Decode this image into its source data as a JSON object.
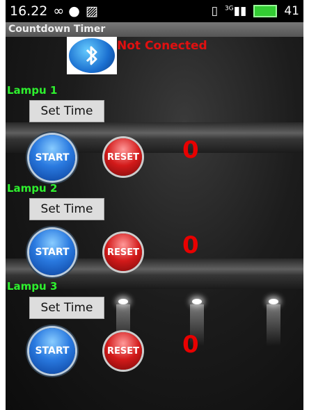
{
  "statusbar": {
    "time": "16.22",
    "left_icons": "∞ ●",
    "signal": "3G",
    "battery": "41"
  },
  "app": {
    "title": "Countdown Timer",
    "connection_status": "Not Conected"
  },
  "timers": [
    {
      "label": "Lampu 1",
      "set_time": "Set Time",
      "start": "START",
      "reset": "RESET",
      "count": "0"
    },
    {
      "label": "Lampu 2",
      "set_time": "Set Time",
      "start": "START",
      "reset": "RESET",
      "count": "0"
    },
    {
      "label": "Lampu 3",
      "set_time": "Set Time",
      "start": "START",
      "reset": "RESET",
      "count": "0"
    }
  ],
  "colors": {
    "status_red": "#e01010",
    "lamp_green": "#2ef02e",
    "count_red": "#e80000"
  }
}
